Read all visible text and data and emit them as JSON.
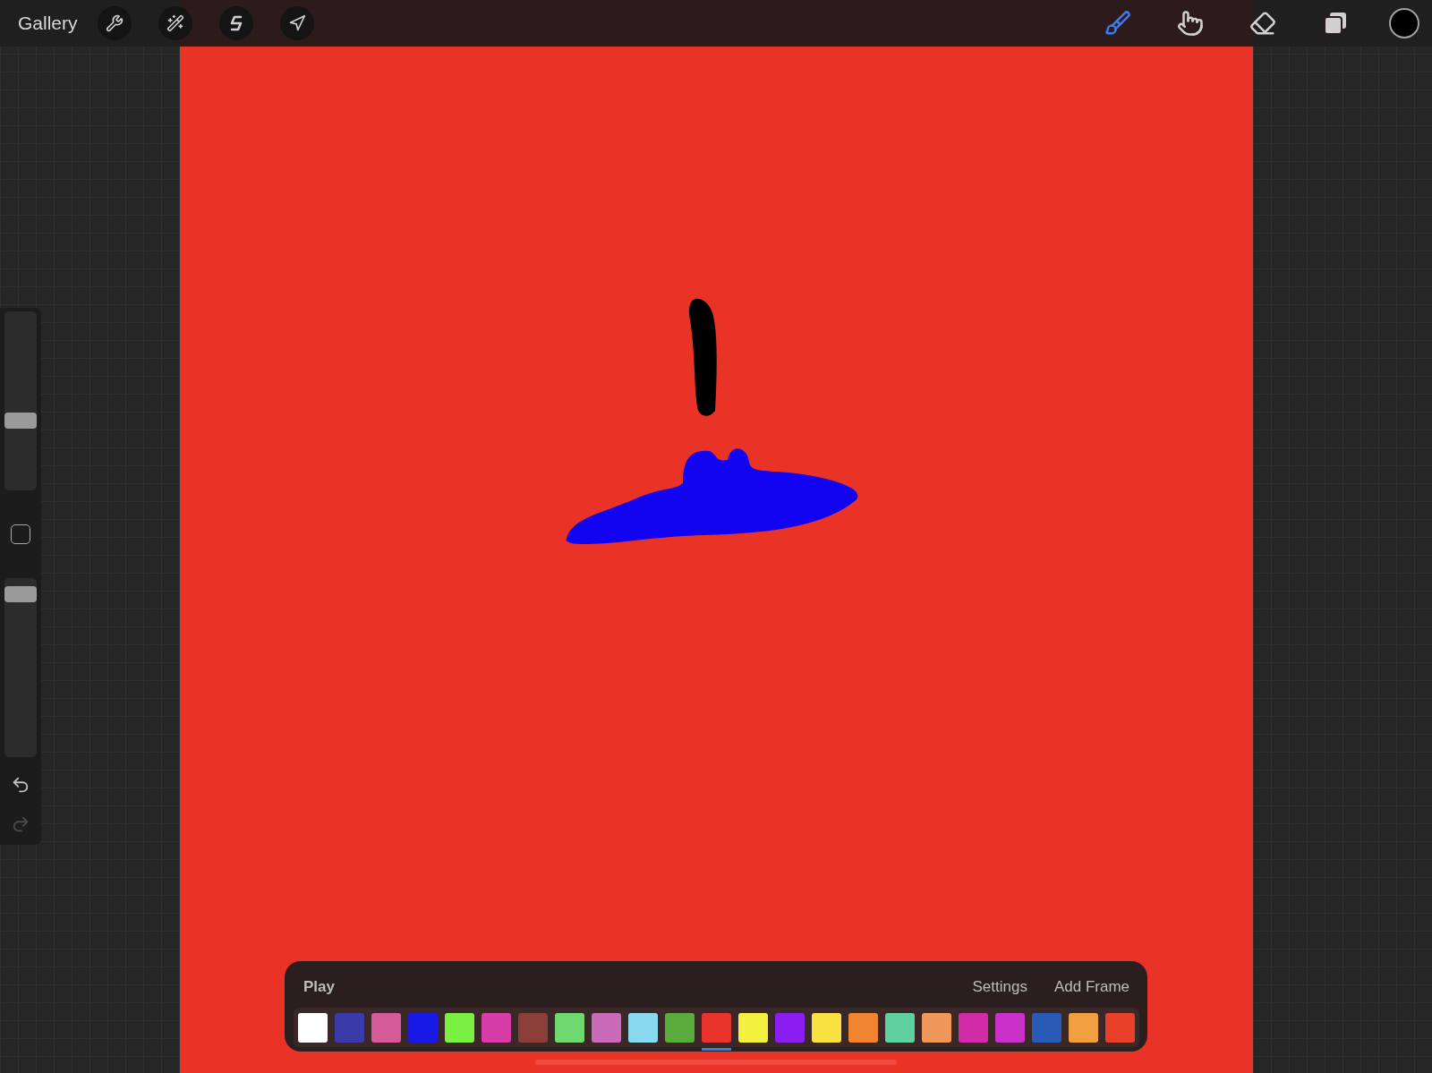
{
  "toolbar": {
    "gallery": "Gallery",
    "tools": [
      {
        "kind": "brush",
        "selected": true
      },
      {
        "kind": "smudge",
        "selected": false
      },
      {
        "kind": "eraser",
        "selected": false
      }
    ],
    "color": "#000000"
  },
  "sidebar": {
    "sliders": [
      {
        "level": 0.38
      },
      {
        "level": 0.95
      }
    ],
    "undo": {
      "disabled": false
    },
    "redo": {
      "disabled": true
    }
  },
  "animation": {
    "title": "Play",
    "actions": [
      "Settings",
      "Add Frame"
    ],
    "frames": [
      {
        "color": "#ffffff",
        "selected": false
      },
      {
        "color": "#3a3aa8",
        "selected": false
      },
      {
        "color": "#d45a9a",
        "selected": false
      },
      {
        "color": "#1a1ae6",
        "selected": false
      },
      {
        "color": "#7cf040",
        "selected": false
      },
      {
        "color": "#d83ca8",
        "selected": false
      },
      {
        "color": "#8a4038",
        "selected": false
      },
      {
        "color": "#70d870",
        "selected": false
      },
      {
        "color": "#c86ab8",
        "selected": false
      },
      {
        "color": "#88d8f0",
        "selected": false
      },
      {
        "color": "#5aaa3c",
        "selected": false
      },
      {
        "color": "#e8342a",
        "selected": true
      },
      {
        "color": "#f4f040",
        "selected": false
      },
      {
        "color": "#8a1ef0",
        "selected": false
      },
      {
        "color": "#f8e040",
        "selected": false
      },
      {
        "color": "#f08430",
        "selected": false
      },
      {
        "color": "#60d0a0",
        "selected": false
      },
      {
        "color": "#f0985a",
        "selected": false
      },
      {
        "color": "#d02ca8",
        "selected": false
      },
      {
        "color": "#c830c8",
        "selected": false
      },
      {
        "color": "#2a5ab8",
        "selected": false
      },
      {
        "color": "#f0a040",
        "selected": false
      },
      {
        "color": "#e84028",
        "selected": false
      }
    ]
  }
}
